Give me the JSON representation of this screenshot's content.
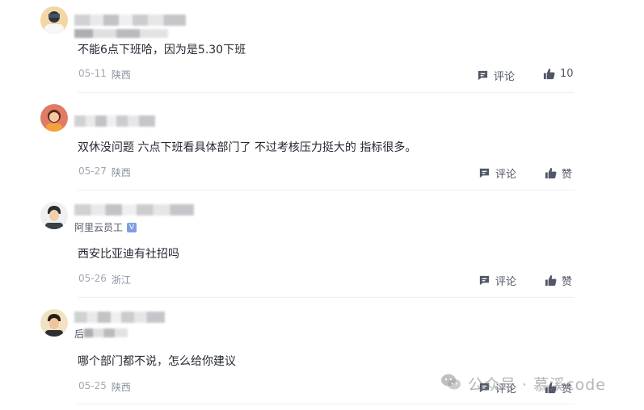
{
  "comments": [
    {
      "content": "不能6点下班哈，因为是5.30下班",
      "date": "05-11",
      "location": "陕西",
      "comment_label": "评论",
      "like_label": "10"
    },
    {
      "content": "双休没问题 六点下班看具体部门了 不过考核压力挺大的 指标很多。",
      "date": "05-27",
      "location": "陕西",
      "comment_label": "评论",
      "like_label": "赞"
    },
    {
      "sub_name": "阿里云员工",
      "verified_mark": "V",
      "content": "西安比亚迪有社招吗",
      "date": "05-26",
      "location": "浙江",
      "comment_label": "评论",
      "like_label": "赞"
    },
    {
      "sub_name_prefix": "后",
      "content": "哪个部门都不说，怎么给你建议",
      "date": "05-25",
      "location": "陕西",
      "comment_label": "评论",
      "like_label": "赞"
    }
  ],
  "watermark": {
    "text": "公众号 · 慕溪code"
  },
  "colors": {
    "text": "#252933",
    "meta": "#8a919f",
    "action": "#515767",
    "divider": "#eef0f3"
  },
  "icons": {
    "comment": "comment-bubble-icon",
    "like": "thumbs-up-icon"
  }
}
